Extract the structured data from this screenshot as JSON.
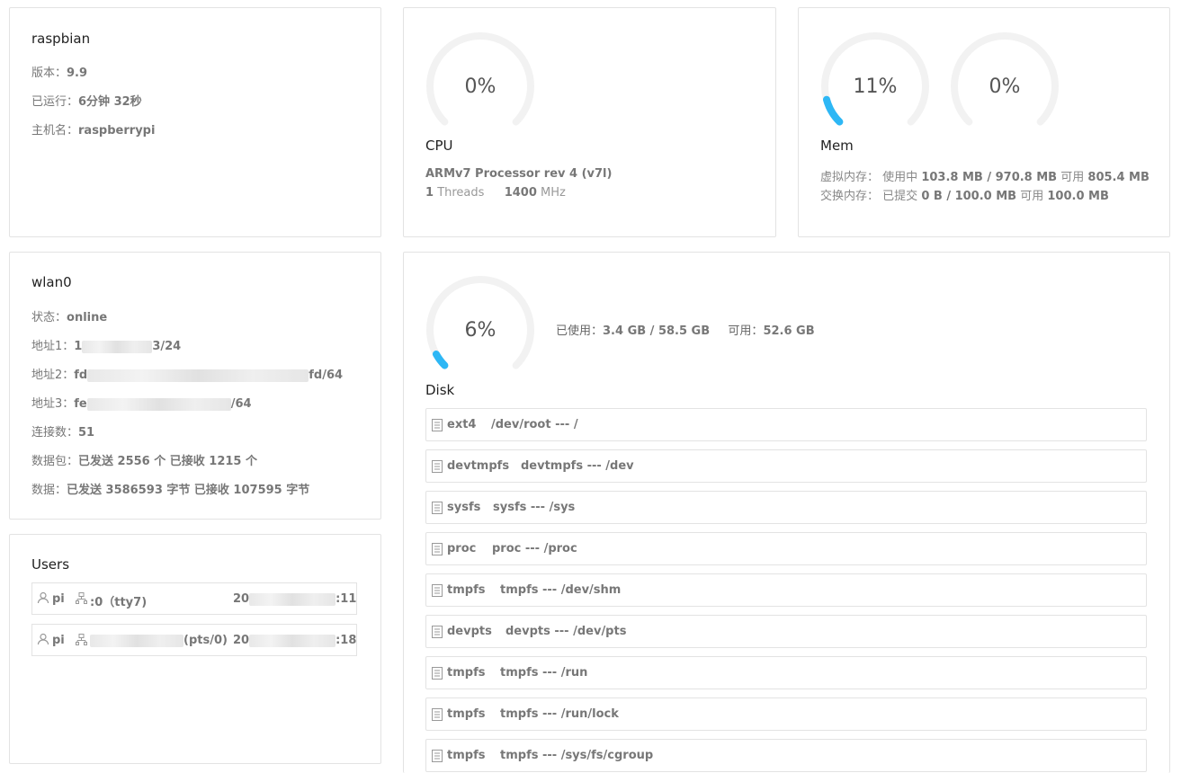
{
  "system": {
    "title": "raspbian",
    "version_label": "版本：",
    "version": "9.9",
    "uptime_label": "已运行：",
    "uptime": "6分钟 32秒",
    "hostname_label": "主机名：",
    "hostname": "raspberrypi"
  },
  "cpu": {
    "percent": "0%",
    "usage": 0,
    "title": "CPU",
    "model": "ARMv7 Processor rev 4 (v7l)",
    "threads": "1",
    "threads_label": "Threads",
    "mhz": "1400",
    "mhz_label": "MHz"
  },
  "mem": {
    "virtual_percent": "11%",
    "virtual_usage": 0.11,
    "swap_percent": "0%",
    "swap_usage": 0,
    "title": "Mem",
    "virtual_label": "虚拟内存：",
    "virtual_used_label": "使用中",
    "virtual_used": "103.8 MB / 970.8 MB",
    "virtual_avail_label": "可用",
    "virtual_avail": "805.4 MB",
    "swap_label": "交换内存：",
    "swap_used_label": "已提交",
    "swap_used": "0 B / 100.0 MB",
    "swap_avail_label": "可用",
    "swap_avail": "100.0 MB"
  },
  "network": {
    "title": "wlan0",
    "status_label": "状态：",
    "status": "online",
    "addr1_label": "地址1：",
    "addr1_prefix": "1",
    "addr1_suffix": "3/24",
    "addr2_label": "地址2：",
    "addr2_prefix": "fd",
    "addr2_suffix": "fd/64",
    "addr3_label": "地址3：",
    "addr3_prefix": "fe",
    "addr3_suffix": "/64",
    "conn_label": "连接数：",
    "conn": "51",
    "packets_label": "数据包：",
    "packets": "已发送 2556 个 已接收 1215 个",
    "bytes_label": "数据：",
    "bytes": "已发送 3586593 字节 已接收 107595 字节"
  },
  "users": {
    "title": "Users",
    "rows": [
      {
        "user": "pi",
        "tty": ":0（tty7)",
        "time_prefix": "20",
        "time_suffix": ":11"
      },
      {
        "user": "pi",
        "tty": "(pts/0)",
        "time_prefix": "20",
        "time_suffix": ":18"
      }
    ]
  },
  "disk": {
    "percent": "6%",
    "usage": 0.06,
    "title": "Disk",
    "used_label": "已使用：",
    "used": "3.4 GB / 58.5 GB",
    "avail_label": "可用：",
    "avail": "52.6 GB",
    "mounts": [
      {
        "type": "ext4",
        "desc": "/dev/root --- /"
      },
      {
        "type": "devtmpfs",
        "desc": "devtmpfs --- /dev"
      },
      {
        "type": "sysfs",
        "desc": "sysfs --- /sys"
      },
      {
        "type": "proc",
        "desc": "proc --- /proc"
      },
      {
        "type": "tmpfs",
        "desc": "tmpfs --- /dev/shm"
      },
      {
        "type": "devpts",
        "desc": "devpts --- /dev/pts"
      },
      {
        "type": "tmpfs",
        "desc": "tmpfs --- /run"
      },
      {
        "type": "tmpfs",
        "desc": "tmpfs --- /run/lock"
      },
      {
        "type": "tmpfs",
        "desc": "tmpfs --- /sys/fs/cgroup"
      }
    ]
  },
  "colors": {
    "gauge_track": "#f2f2f2",
    "gauge_fill": "#2db7f5"
  }
}
